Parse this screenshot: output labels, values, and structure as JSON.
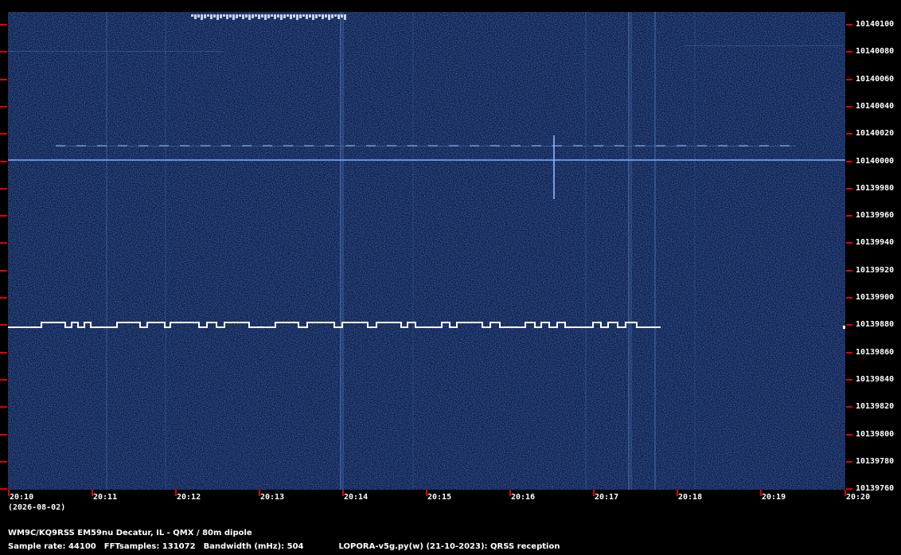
{
  "frequency_axis": {
    "labels": [
      "10140100",
      "10140080",
      "10140060",
      "10140040",
      "10140020",
      "10140000",
      "10139980",
      "10139960",
      "10139940",
      "10139920",
      "10139900",
      "10139880",
      "10139860",
      "10139840",
      "10139820",
      "10139800",
      "10139780",
      "10139760"
    ]
  },
  "time_axis": {
    "labels": [
      "20:10",
      "20:11",
      "20:12",
      "20:13",
      "20:14",
      "20:15",
      "20:16",
      "20:17",
      "20:18",
      "20:19",
      "20:20"
    ],
    "date": "(2026-08-02)"
  },
  "info": {
    "station": "WM9C/KQ9RSS EM59nu Decatur, IL - QMX / 80m dipole",
    "sample_rate": "Sample rate: 44100",
    "fft_samples": "FFTsamples: 131072",
    "bandwidth": "Bandwidth (mHz): 504",
    "program": "LOPORA-v5g.py(w) (21-10-2023): QRSS reception"
  },
  "colors": {
    "background": "#000000",
    "spectrogram_base": "#0d1f4c",
    "signal": "#ffffff",
    "tick": "#e00000",
    "text": "#ffffff"
  }
}
